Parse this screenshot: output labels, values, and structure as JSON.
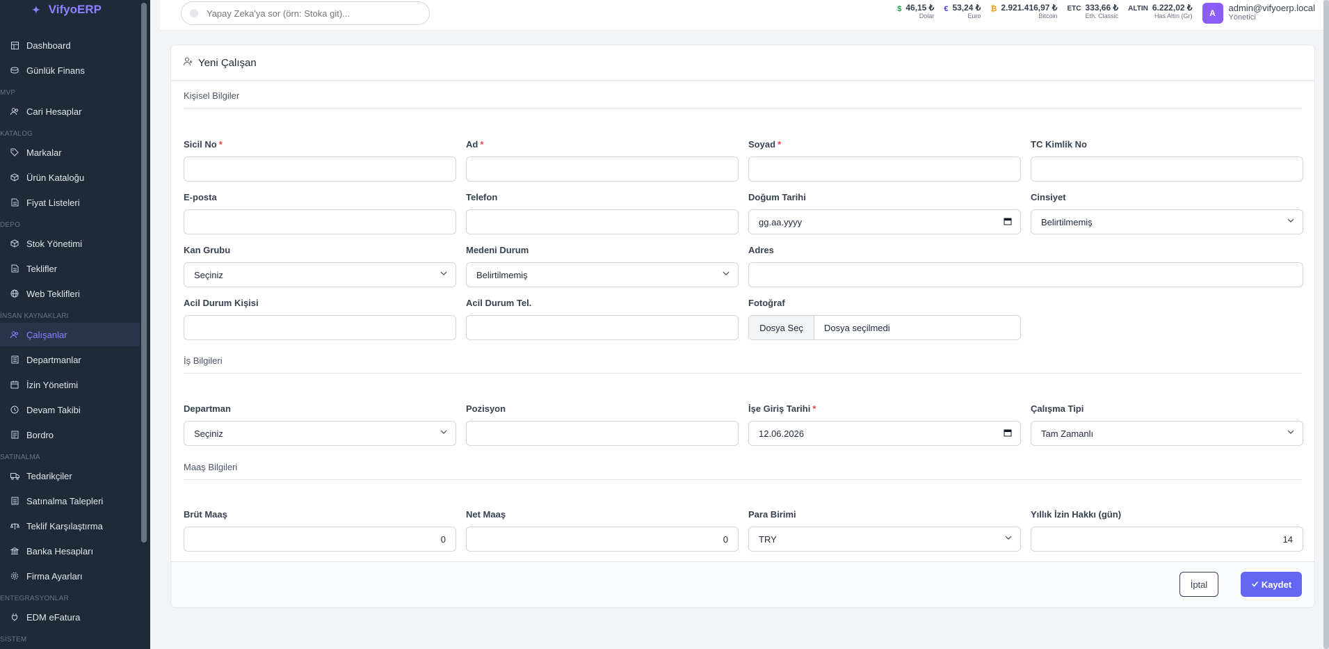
{
  "app": {
    "brand": "VifyoERP"
  },
  "sidebar": {
    "sections": {
      "mvp": "MVP",
      "katalog": "KATALOG",
      "depo": "DEPO",
      "insan": "İNSAN KAYNAKLARI",
      "satinalma": "SATINALMA",
      "entegrasyon": "ENTEGRASYONLAR",
      "sistem": "SİSTEM"
    },
    "items": [
      {
        "label": "Dashboard",
        "icon": "dashboard-icon"
      },
      {
        "label": "Günlük Finans",
        "icon": "finance-icon"
      },
      {
        "label": "Cari Hesaplar",
        "icon": "users-icon"
      },
      {
        "label": "Markalar",
        "icon": "tag-icon"
      },
      {
        "label": "Ürün Kataloğu",
        "icon": "box-icon"
      },
      {
        "label": "Fiyat Listeleri",
        "icon": "price-list-icon"
      },
      {
        "label": "Stok Yönetimi",
        "icon": "stock-icon"
      },
      {
        "label": "Teklifler",
        "icon": "document-icon"
      },
      {
        "label": "Web Teklifleri",
        "icon": "globe-icon"
      },
      {
        "label": "Çalışanlar",
        "icon": "employees-icon",
        "active": true
      },
      {
        "label": "Departmanlar",
        "icon": "building-icon"
      },
      {
        "label": "İzin Yönetimi",
        "icon": "calendar-icon"
      },
      {
        "label": "Devam Takibi",
        "icon": "clock-icon"
      },
      {
        "label": "Bordro",
        "icon": "payroll-icon"
      },
      {
        "label": "Tedarikçiler",
        "icon": "truck-icon"
      },
      {
        "label": "Satınalma Talepleri",
        "icon": "cart-icon"
      },
      {
        "label": "Teklif Karşılaştırma",
        "icon": "scale-icon"
      },
      {
        "label": "Banka Hesapları",
        "icon": "bank-icon"
      },
      {
        "label": "Firma Ayarları",
        "icon": "settings-icon"
      },
      {
        "label": "EDM eFatura",
        "icon": "plug-icon"
      }
    ]
  },
  "topbar": {
    "search_placeholder": "Yapay Zeka'ya sor (örn: Stoka git)...",
    "rates": [
      {
        "symbol": "$",
        "value": "46,15 ₺",
        "label": "Dolar",
        "color": "#16a34a"
      },
      {
        "symbol": "€",
        "value": "53,24 ₺",
        "label": "Euro",
        "color": "#4f46e5"
      },
      {
        "symbol": "₿",
        "value": "2.921.416,97 ₺",
        "label": "Bitcoin",
        "color": "#f59e0b"
      },
      {
        "symbol": "ETC",
        "value": "333,66 ₺",
        "label": "Eth. Classic",
        "color": "#374151"
      },
      {
        "symbol": "ALTIN",
        "value": "6.222,02 ₺",
        "label": "Has Altın (Gr)",
        "color": "#374151"
      }
    ],
    "user": {
      "initial": "A",
      "email": "admin@vifyoerp.local",
      "role": "Yönetici"
    }
  },
  "form": {
    "title": "Yeni Çalışan",
    "sections": {
      "personal": "Kişisel Bilgiler",
      "job": "İş Bilgileri",
      "salary": "Maaş Bilgileri"
    },
    "fields": {
      "sicil_no": {
        "label": "Sicil No",
        "value": ""
      },
      "ad": {
        "label": "Ad",
        "value": ""
      },
      "soyad": {
        "label": "Soyad",
        "value": ""
      },
      "tc": {
        "label": "TC Kimlik No",
        "value": ""
      },
      "eposta": {
        "label": "E-posta",
        "value": ""
      },
      "telefon": {
        "label": "Telefon",
        "value": ""
      },
      "dogum": {
        "label": "Doğum Tarihi",
        "value": "gg.aa.yyyy"
      },
      "cinsiyet": {
        "label": "Cinsiyet",
        "value": "Belirtilmemiş"
      },
      "kan": {
        "label": "Kan Grubu",
        "value": "Seçiniz"
      },
      "medeni": {
        "label": "Medeni Durum",
        "value": "Belirtilmemiş"
      },
      "adres": {
        "label": "Adres",
        "value": ""
      },
      "acil_kisi": {
        "label": "Acil Durum Kişisi",
        "value": ""
      },
      "acil_tel": {
        "label": "Acil Durum Tel.",
        "value": ""
      },
      "foto": {
        "label": "Fotoğraf",
        "button": "Dosya Seç",
        "value": "Dosya seçilmedi"
      },
      "departman": {
        "label": "Departman",
        "value": "Seçiniz"
      },
      "pozisyon": {
        "label": "Pozisyon",
        "value": ""
      },
      "ise_giris": {
        "label": "İşe Giriş Tarihi",
        "value": "12.06.2026"
      },
      "calisma": {
        "label": "Çalışma Tipi",
        "value": "Tam Zamanlı"
      },
      "brut": {
        "label": "Brüt Maaş",
        "value": "0"
      },
      "net": {
        "label": "Net Maaş",
        "value": "0"
      },
      "para": {
        "label": "Para Birimi",
        "value": "TRY"
      },
      "izin": {
        "label": "Yıllık İzin Hakkı (gün)",
        "value": "14"
      }
    },
    "required_mark": "*",
    "buttons": {
      "cancel": "İptal",
      "save": "Kaydet"
    }
  }
}
